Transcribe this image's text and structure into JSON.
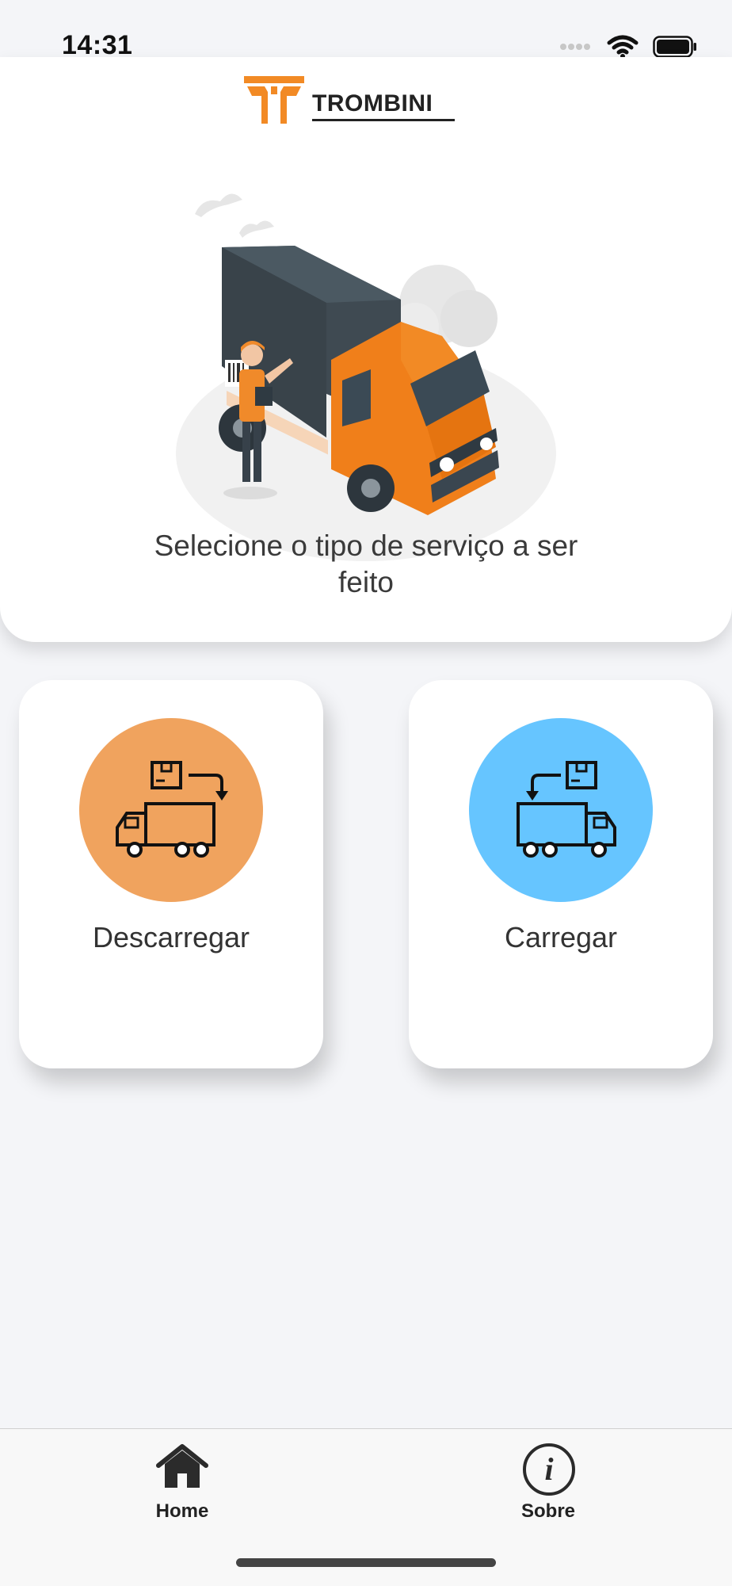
{
  "status_bar": {
    "time": "14:31"
  },
  "brand": {
    "logo_text": "TROMBINI",
    "accent": "#f28a25"
  },
  "hero": {
    "prompt": "Selecione o tipo de serviço a ser feito"
  },
  "services": [
    {
      "label": "Descarregar",
      "icon": "truck-unload-icon",
      "color": "#f0a35e"
    },
    {
      "label": "Carregar",
      "icon": "truck-load-icon",
      "color": "#66c5ff"
    }
  ],
  "tab_bar": {
    "items": [
      {
        "label": "Home",
        "icon": "home-icon"
      },
      {
        "label": "Sobre",
        "icon": "info-icon"
      }
    ]
  }
}
